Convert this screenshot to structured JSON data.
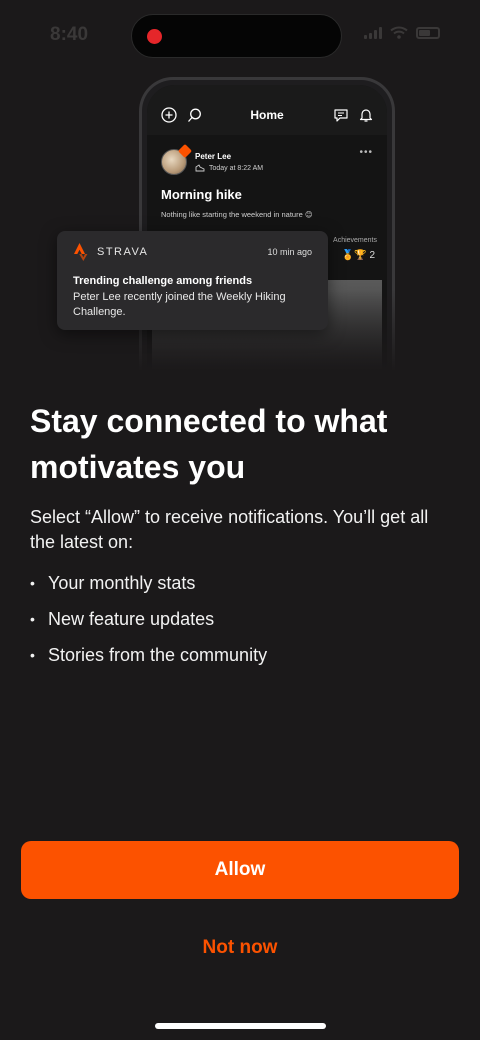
{
  "status_bar": {
    "time": "8:40"
  },
  "phone_mockup": {
    "header_title": "Home",
    "post": {
      "author": "Peter Lee",
      "timestamp": "Today at 8:22 AM",
      "title": "Morning hike",
      "description": "Nothing like starting the weekend in nature 😊",
      "achievements_label": "Achievements",
      "achievements_count": "2"
    }
  },
  "notification": {
    "brand": "STRAVA",
    "time": "10 min ago",
    "title": "Trending challenge among friends",
    "body": "Peter Lee recently joined the Weekly Hiking Challenge."
  },
  "content": {
    "headline": "Stay connected to what motivates you",
    "intro": "Select “Allow” to receive notifications. You’ll get all the latest on:",
    "bullets": [
      "Your monthly stats",
      "New feature updates",
      "Stories from the community"
    ]
  },
  "actions": {
    "allow_label": "Allow",
    "not_now_label": "Not now"
  },
  "colors": {
    "background": "#1b191a",
    "accent": "#fc5200",
    "card": "#2b2a2c"
  }
}
